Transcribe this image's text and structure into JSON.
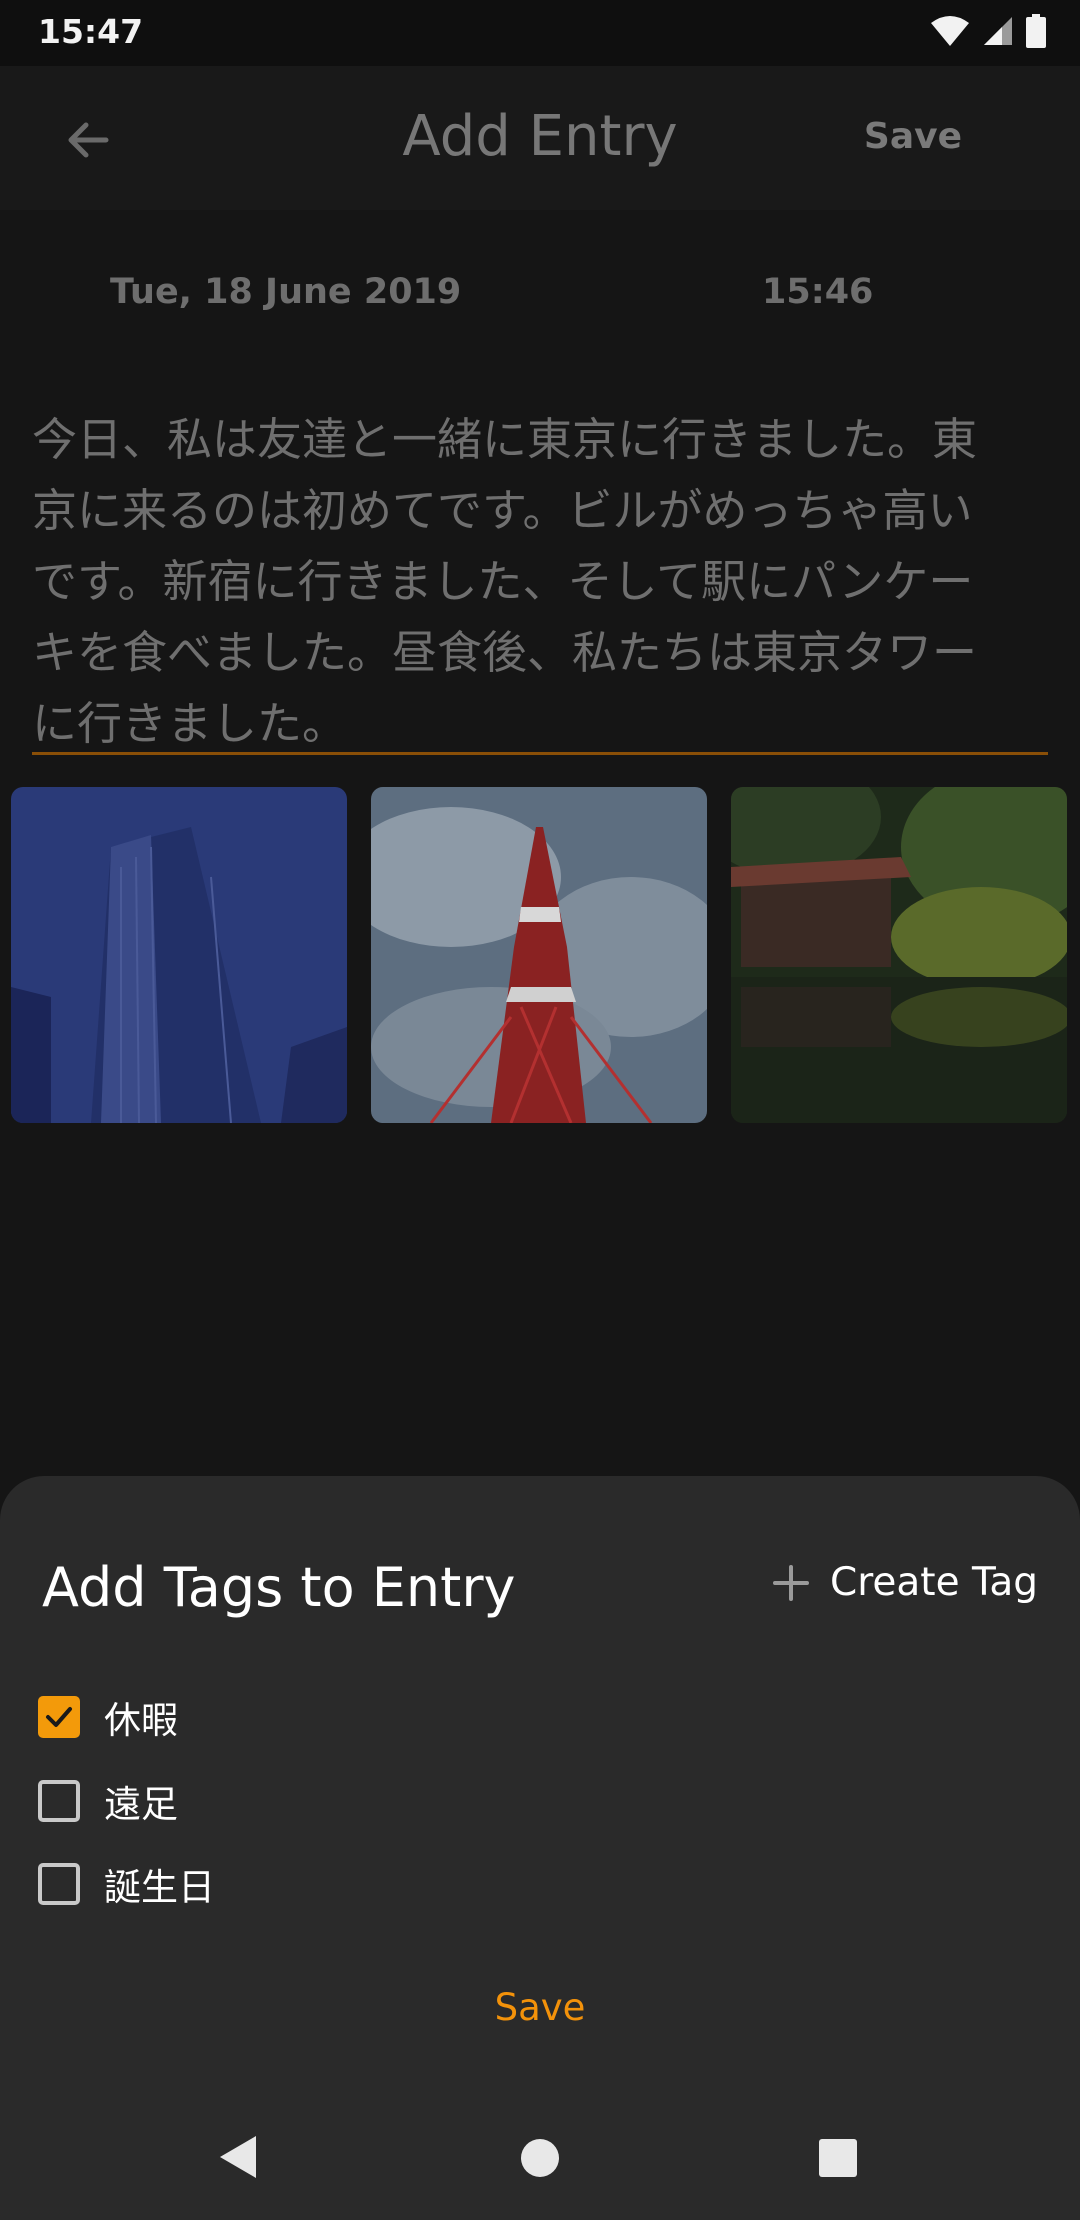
{
  "status_bar": {
    "time": "15:47"
  },
  "app_bar": {
    "title": "Add Entry",
    "save_label": "Save",
    "back_icon": "arrow-left-icon"
  },
  "entry": {
    "date": "Tue, 18 June 2019",
    "time": "15:46",
    "text_lines": [
      "今日、私は友達と一緒に東京に行きました。東",
      "京に来るのは初めてです。ビルがめっちゃ高い",
      "です。新宿に行きました、そして駅にパンケー",
      "キを食べました。昼食後、私たちは東京タワー",
      "に行きました。"
    ],
    "photos": [
      "skyscraper-photo",
      "tokyo-tower-photo",
      "garden-pond-photo"
    ]
  },
  "tag_sheet": {
    "title": "Add Tags to Entry",
    "create_tag_label": "Create Tag",
    "tags": [
      {
        "label": "休暇",
        "checked": true
      },
      {
        "label": "遠足",
        "checked": false
      },
      {
        "label": "誕生日",
        "checked": false
      }
    ],
    "save_label": "Save"
  },
  "colors": {
    "accent": "#f39a0a",
    "sheet_bg": "#2a2a2a",
    "background": "#151515"
  }
}
